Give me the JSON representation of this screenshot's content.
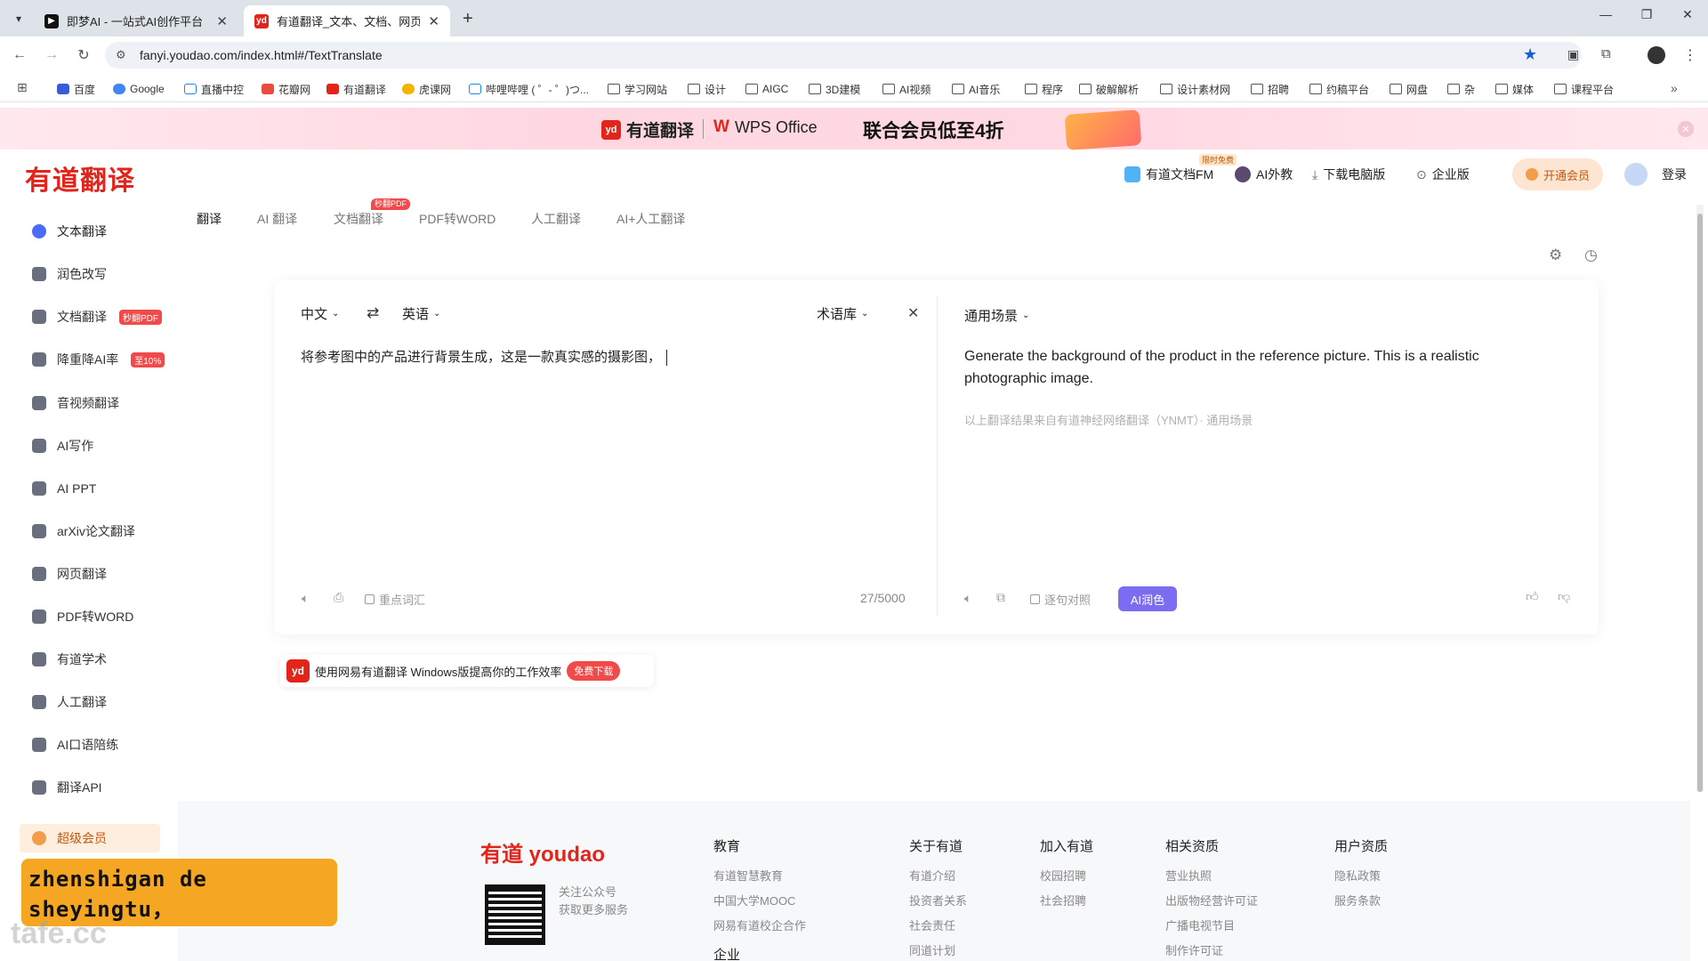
{
  "browser": {
    "tabs": [
      {
        "title": "即梦AI - 一站式AI创作平台",
        "favicon": "jimeng-icon",
        "active": false
      },
      {
        "title": "有道翻译_文本、文档、网页、…",
        "favicon": "youdao-icon",
        "active": true
      }
    ],
    "url": "fanyi.youdao.com/index.html#/TextTranslate",
    "bookmarks": [
      "百度",
      "Google",
      "直播中控",
      "花瓣网",
      "有道翻译",
      "虎课网",
      "哔哩哔哩 ( ゜- ゜)つ...",
      "学习网站",
      "设计",
      "AIGC",
      "3D建模",
      "AI视频",
      "AI音乐",
      "程序",
      "破解解析",
      "设计素材网",
      "招聘",
      "约稿平台",
      "网盘",
      "杂",
      "媒体",
      "课程平台"
    ]
  },
  "banner": {
    "brand1": "有道翻译",
    "brand2": "WPS Office",
    "slogan": "联合会员低至4折"
  },
  "header": {
    "logo": "有道翻译",
    "links": [
      "有道文档FM",
      "AI外教",
      "下载电脑版",
      "企业版"
    ],
    "limited_badge": "限时免费",
    "vip": "开通会员",
    "login": "登录"
  },
  "sidebar": {
    "items": [
      {
        "label": "文本翻译",
        "tag": ""
      },
      {
        "label": "润色改写",
        "tag": ""
      },
      {
        "label": "文档翻译",
        "tag": "秒翻PDF"
      },
      {
        "label": "降重降AI率",
        "tag": "至10%"
      },
      {
        "label": "音视频翻译",
        "tag": ""
      },
      {
        "label": "AI写作",
        "tag": ""
      },
      {
        "label": "AI PPT",
        "tag": ""
      },
      {
        "label": "arXiv论文翻译",
        "tag": ""
      },
      {
        "label": "网页翻译",
        "tag": ""
      },
      {
        "label": "PDF转WORD",
        "tag": ""
      },
      {
        "label": "有道学术",
        "tag": ""
      },
      {
        "label": "人工翻译",
        "tag": ""
      },
      {
        "label": "AI口语陪练",
        "tag": ""
      },
      {
        "label": "翻译API",
        "tag": ""
      }
    ],
    "vip": "超级会员"
  },
  "main_tabs": {
    "items": [
      "翻译",
      "AI 翻译",
      "文档翻译",
      "PDF转WORD",
      "人工翻译",
      "AI+人工翻译"
    ],
    "doc_badge": "秒翻PDF"
  },
  "translator": {
    "source_lang": "中文",
    "target_lang": "英语",
    "glossary": "术语库",
    "scene": "通用场景",
    "input_text": "将参考图中的产品进行背景生成，这是一款真实感的摄影图，",
    "output_text": "Generate the background of the product in the reference picture. This is a realistic photographic image.",
    "source_note": "以上翻译结果来自有道神经网络翻译（YNMT）· 通用场景",
    "keyword_label": "重点词汇",
    "char_count": "27/5000",
    "compare_label": "逐句对照",
    "ai_polish": "AI润色"
  },
  "promo": {
    "text": "使用网易有道翻译 Windows版提高你的工作效率",
    "button": "免费下载"
  },
  "footer": {
    "logo": "有道 youdao",
    "qr_caption1": "关注公众号",
    "qr_caption2": "获取更多服务",
    "columns": [
      {
        "title": "教育",
        "links": [
          "有道智慧教育",
          "中国大学MOOC",
          "网易有道校企合作"
        ]
      },
      {
        "title": "关于有道",
        "links": [
          "有道介绍",
          "投资者关系",
          "社会责任",
          "同道计划"
        ]
      },
      {
        "title": "加入有道",
        "links": [
          "校园招聘",
          "社会招聘"
        ]
      },
      {
        "title": "相关资质",
        "links": [
          "营业执照",
          "出版物经营许可证",
          "广播电视节目",
          "制作许可证"
        ]
      },
      {
        "title": "用户资质",
        "links": [
          "隐私政策",
          "服务条款"
        ]
      }
    ],
    "extra_title": "企业"
  },
  "overlay": {
    "text": "zhenshigan de sheyingtu，"
  },
  "watermark": "tafe.cc"
}
